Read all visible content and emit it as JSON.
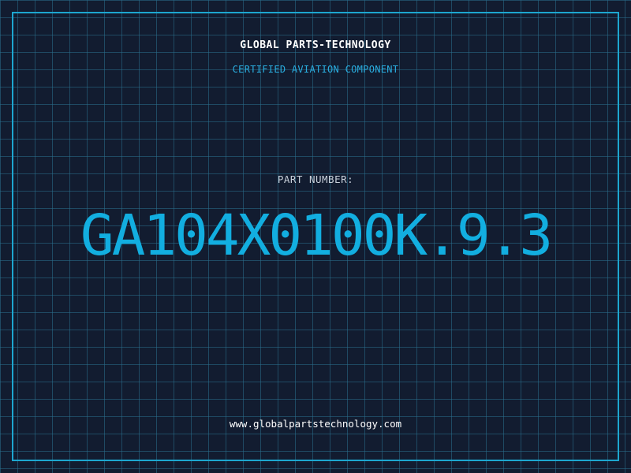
{
  "header": {
    "company": "GLOBAL PARTS-TECHNOLOGY",
    "subtitle": "CERTIFIED AVIATION COMPONENT"
  },
  "part": {
    "label": "PART NUMBER:",
    "number": "GA104X0100K.9.3"
  },
  "footer": {
    "url": "www.globalpartstechnology.com"
  },
  "colors": {
    "background": "#121c30",
    "grid": "#2a6e8c",
    "accent": "#12aee0",
    "text": "#ffffff"
  }
}
